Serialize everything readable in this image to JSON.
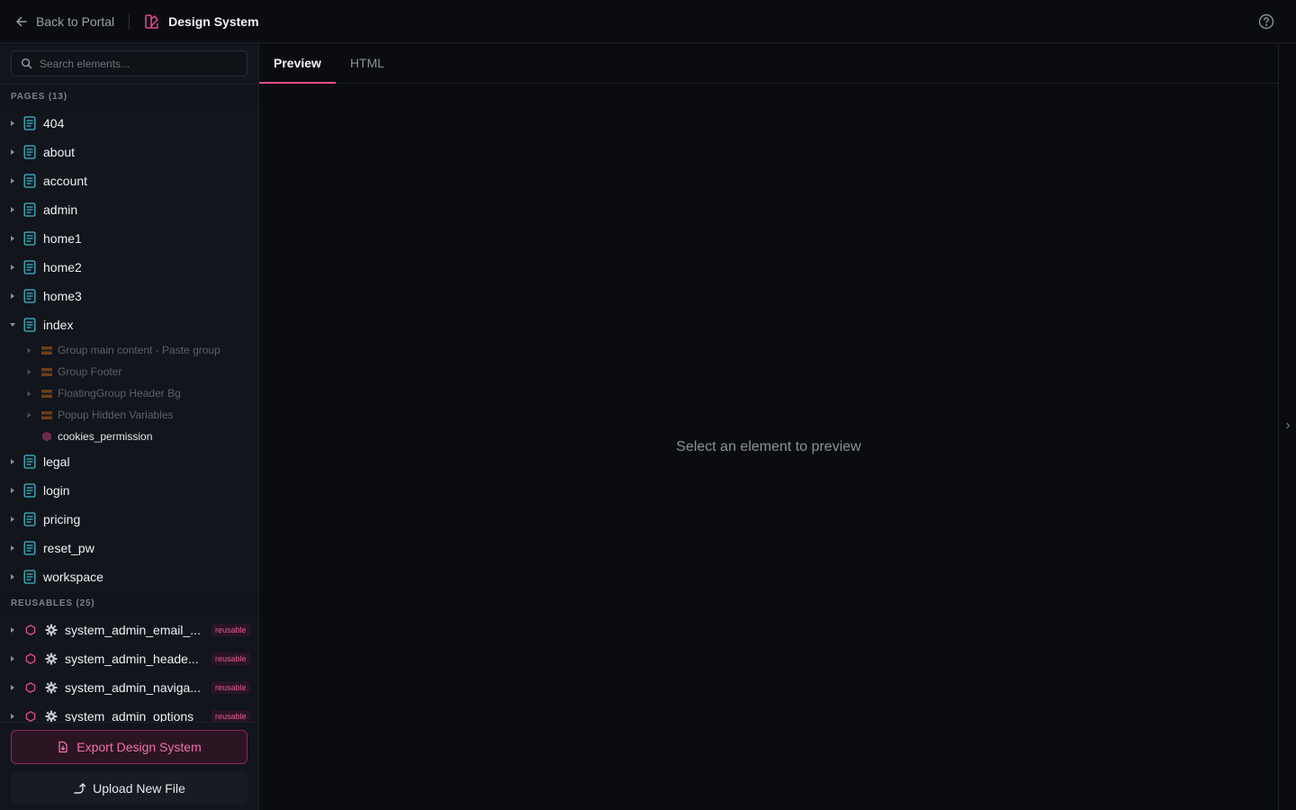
{
  "topbar": {
    "back_label": "Back to Portal",
    "brand_title": "Design System"
  },
  "sidebar": {
    "search_placeholder": "Search elements...",
    "pages_header": "PAGES (13)",
    "pages": [
      {
        "label": "404",
        "expanded": false
      },
      {
        "label": "about",
        "expanded": false
      },
      {
        "label": "account",
        "expanded": false
      },
      {
        "label": "admin",
        "expanded": false
      },
      {
        "label": "home1",
        "expanded": false
      },
      {
        "label": "home2",
        "expanded": false
      },
      {
        "label": "home3",
        "expanded": false
      },
      {
        "label": "index",
        "expanded": true
      },
      {
        "label": "legal",
        "expanded": false
      },
      {
        "label": "login",
        "expanded": false
      },
      {
        "label": "pricing",
        "expanded": false
      },
      {
        "label": "reset_pw",
        "expanded": false
      },
      {
        "label": "workspace",
        "expanded": false
      }
    ],
    "index_children": [
      {
        "label": "Group main content - Paste group",
        "type": "group"
      },
      {
        "label": "Group Footer",
        "type": "group"
      },
      {
        "label": "FloatingGroup Header Bg",
        "type": "group"
      },
      {
        "label": "Popup Hidden Variables",
        "type": "group"
      },
      {
        "label": "cookies_permission",
        "type": "reusable"
      }
    ],
    "reusables_header": "REUSABLES (25)",
    "reusables": [
      {
        "label": "system_admin_email_...",
        "badge": "reusable"
      },
      {
        "label": "system_admin_heade...",
        "badge": "reusable"
      },
      {
        "label": "system_admin_naviga...",
        "badge": "reusable"
      },
      {
        "label": "system_admin_options",
        "badge": "reusable"
      }
    ],
    "export_label": "Export Design System",
    "upload_label": "Upload New File"
  },
  "main": {
    "tabs": [
      {
        "label": "Preview",
        "active": true
      },
      {
        "label": "HTML",
        "active": false
      }
    ],
    "empty_message": "Select an element to preview"
  },
  "colors": {
    "accent": "#e34d93",
    "page_icon": "#3fb9c9",
    "group_icon": "#7a4a1e"
  }
}
